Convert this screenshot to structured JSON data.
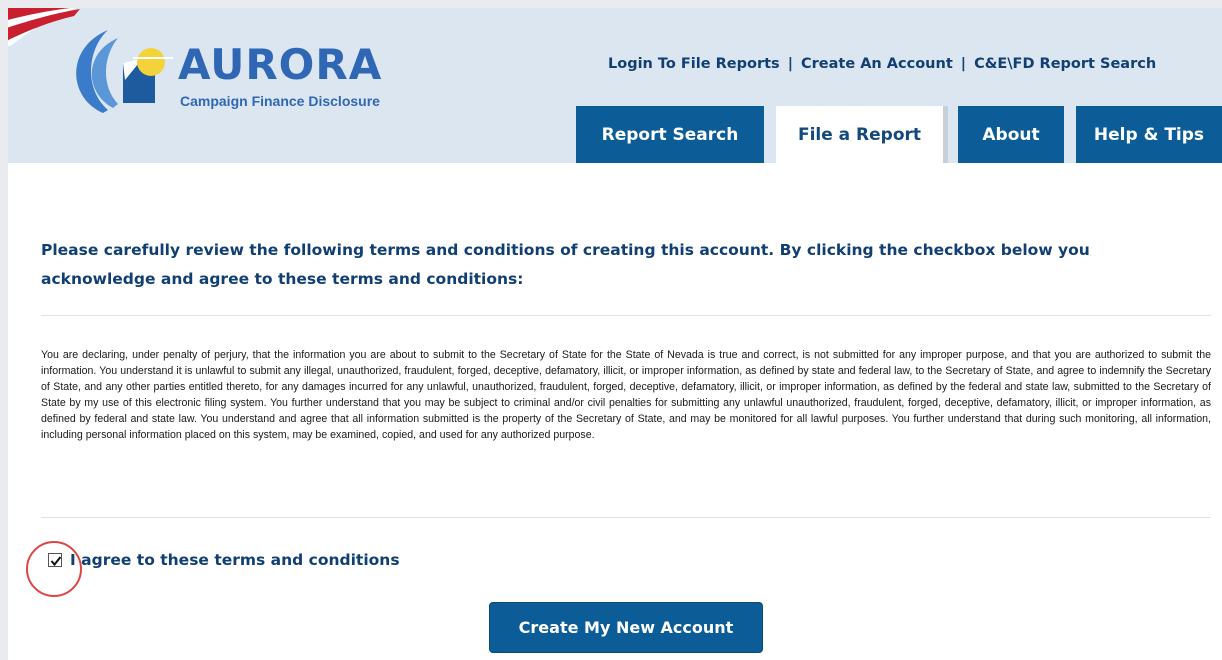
{
  "header": {
    "brand": "AURORA",
    "tagline": "Campaign Finance Disclosure",
    "top_links": {
      "login": "Login To File Reports",
      "create_account": "Create An Account",
      "report_search": "C&E\\FD Report Search",
      "separator": "|"
    },
    "tabs": [
      {
        "label": "Report Search",
        "active": false
      },
      {
        "label": "File a Report",
        "active": true
      },
      {
        "label": "About",
        "active": false
      },
      {
        "label": "Help & Tips",
        "active": false
      }
    ]
  },
  "main": {
    "heading": "Please carefully review the following terms and conditions of creating this account. By clicking the checkbox below you acknowledge and agree to these terms and conditions:",
    "terms_text": "You are declaring, under penalty of perjury, that the information you are about to submit to the Secretary of State for the State of Nevada is true and correct, is not submitted for any improper purpose, and that you are authorized to submit the information. You understand it is unlawful to submit any illegal, unauthorized, fraudulent, forged, deceptive, defamatory, illicit, or improper information, as defined by state and federal law, to the Secretary of State, and agree to indemnify the Secretary of State, and any other parties entitled thereto, for any damages incurred for any unlawful, unauthorized, fraudulent, forged, deceptive, defamatory, illicit, or improper information, as defined by the federal and state law, submitted to the Secretary of State by my use of this electronic filing system. You further understand that you may be subject to criminal and/or civil penalties for submitting any unlawful unauthorized, fraudulent, forged, deceptive, defamatory, illicit, or improper information, as defined by federal and state law. You understand and agree that all information submitted is the property of the Secretary of State, and may be monitored for all lawful purposes. You further understand that during such monitoring, all information, including personal information placed on this system, may be examined, copied, and used for any authorized purpose.",
    "agree_label": "I agree to these terms and conditions",
    "agree_checked": true,
    "submit_label": "Create My New Account"
  },
  "colors": {
    "header_bg": "#dbe6f1",
    "tab_blue": "#0c5c97",
    "heading_navy": "#123f73",
    "brand_blue": "#2f67b4",
    "highlight_red": "#e04545"
  }
}
